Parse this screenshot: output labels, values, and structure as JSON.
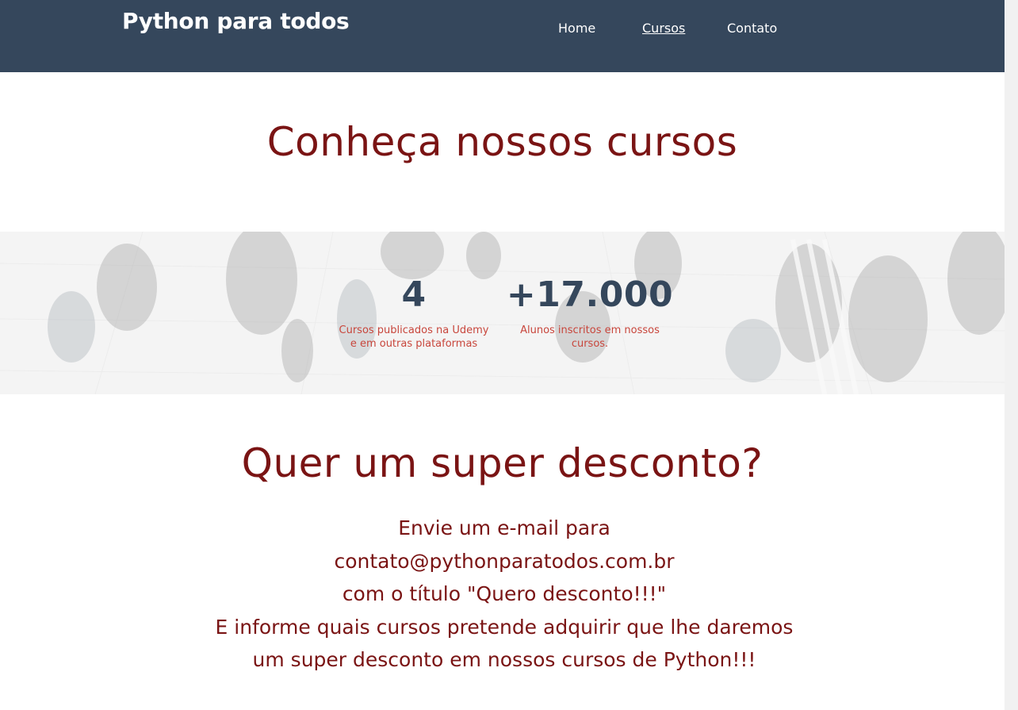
{
  "header": {
    "brand": "Python para todos",
    "nav": [
      {
        "label": "Home",
        "active": false
      },
      {
        "label": "Cursos",
        "active": true
      },
      {
        "label": "Contato",
        "active": false
      }
    ]
  },
  "courses": {
    "title": "Conheça nossos cursos"
  },
  "stats": [
    {
      "number": "4",
      "caption": "Cursos publicados na Udemy e em outras plataformas"
    },
    {
      "number": "+17.000",
      "caption": "Alunos inscritos em nossos cursos."
    }
  ],
  "discount": {
    "title": "Quer um super desconto?",
    "lines": [
      "Envie um e-mail para",
      "contato@pythonparatodos.com.br",
      "com o título \"Quero desconto!!!\"",
      "E informe quais cursos pretende adquirir que lhe daremos",
      "um super desconto em nossos cursos de Python!!!"
    ]
  },
  "colors": {
    "header_bg": "#35475c",
    "accent_red": "#7a1414",
    "stat_number": "#35475c",
    "stat_caption": "#c8463c"
  }
}
